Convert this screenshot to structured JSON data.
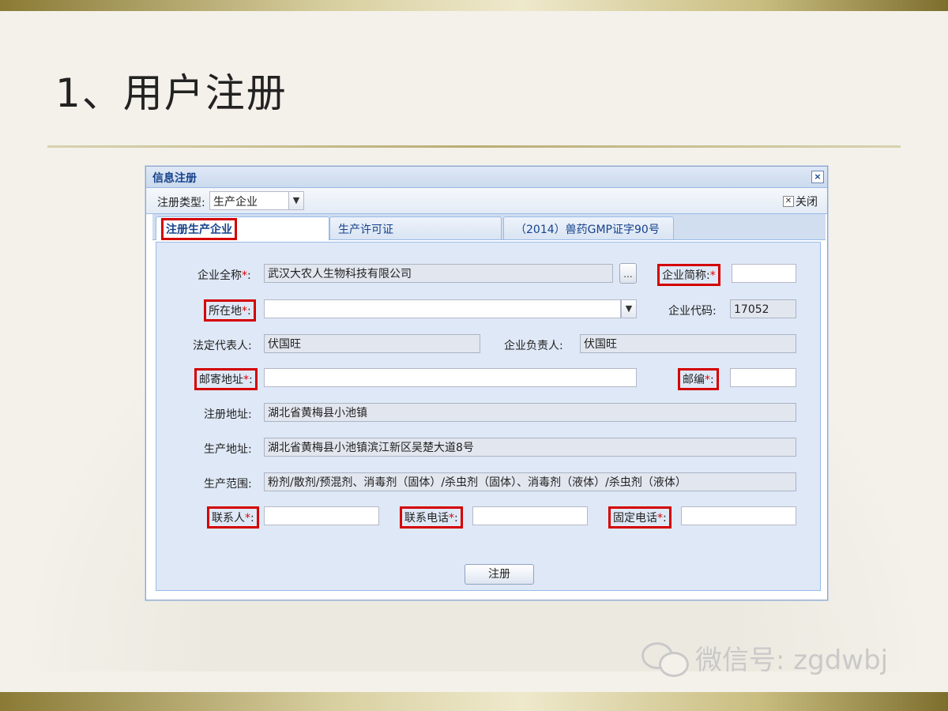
{
  "slide": {
    "title": "1、用户注册"
  },
  "dialog": {
    "title": "信息注册",
    "close_glyph": "×",
    "toolbar": {
      "type_label": "注册类型:",
      "type_value": "生产企业",
      "close_label": "关闭"
    },
    "tabs": [
      {
        "label": "注册生产企业",
        "active": true
      },
      {
        "label": "生产许可证",
        "active": false
      },
      {
        "label": "（2014）兽药GMP证字90号",
        "active": false
      }
    ],
    "form": {
      "company_name": {
        "label": "企业全称",
        "value": "武汉大农人生物科技有限公司"
      },
      "short_name": {
        "label": "企业简称:",
        "value": ""
      },
      "location": {
        "label": "所在地",
        "value": ""
      },
      "company_code": {
        "label": "企业代码:",
        "value": "17052"
      },
      "legal_rep": {
        "label": "法定代表人:",
        "value": "伏国旺"
      },
      "manager": {
        "label": "企业负责人:",
        "value": "伏国旺"
      },
      "mail_address": {
        "label": "邮寄地址",
        "value": ""
      },
      "postcode": {
        "label": "邮编",
        "value": ""
      },
      "reg_address": {
        "label": "注册地址:",
        "value": "湖北省黄梅县小池镇"
      },
      "prod_address": {
        "label": "生产地址:",
        "value": "湖北省黄梅县小池镇滨江新区吴楚大道8号"
      },
      "prod_scope": {
        "label": "生产范围:",
        "value": "粉剂/散剂/预混剂、消毒剂（固体）/杀虫剂（固体）、消毒剂（液体）/杀虫剂（液体）"
      },
      "contact": {
        "label": "联系人",
        "value": ""
      },
      "contact_phone": {
        "label": "联系电话",
        "value": ""
      },
      "fixed_phone": {
        "label": "固定电话",
        "value": ""
      },
      "required_mark": "*",
      "colon": ":",
      "dots_label": "...",
      "submit_label": "注册"
    }
  },
  "watermark": {
    "text": "微信号: zgdwbj"
  },
  "colors": {
    "highlight": "#d40000",
    "dialog_header": "#15428b"
  }
}
